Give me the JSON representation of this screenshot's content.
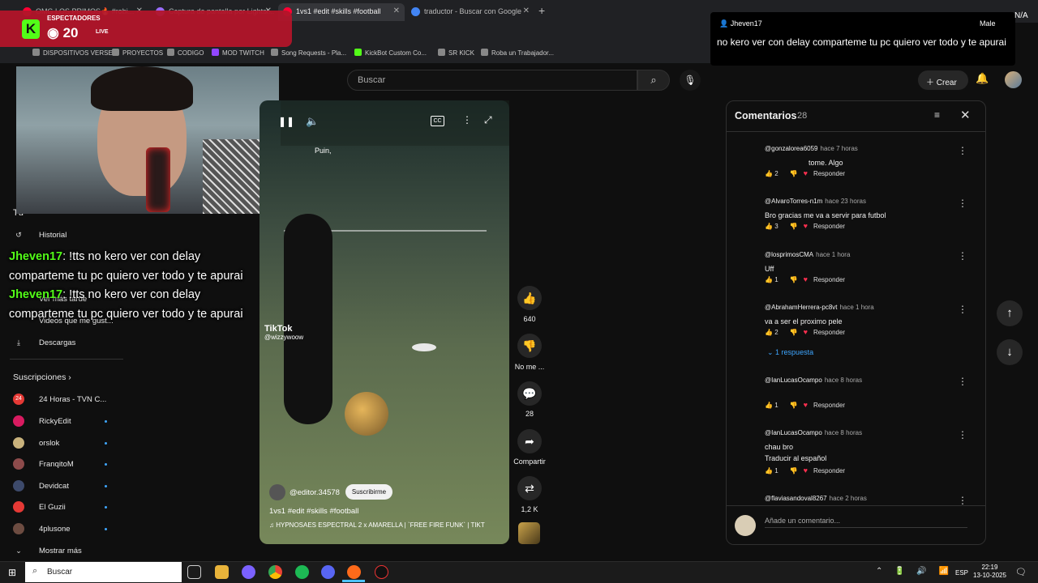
{
  "browser": {
    "tabs": [
      {
        "label": "OMG LOS PRIMOS🔥 #robi...",
        "favicon_color": "#ff0033"
      },
      {
        "label": "Captura de pantalla por Lightsl...",
        "favicon_color": "#9b6bff"
      },
      {
        "label": "1vs1 #edit #skills #football",
        "favicon_color": "#ff0033"
      },
      {
        "label": "traductor - Buscar con Google",
        "favicon_color": "#4285f4"
      }
    ],
    "new_tab": "+",
    "bookmarks": [
      {
        "label": "DISPOSITIVOS VERSE"
      },
      {
        "label": "PROYECTOS"
      },
      {
        "label": "CODIGO"
      },
      {
        "label": "MOD TWITCH"
      },
      {
        "label": "Song Requests - Pla..."
      },
      {
        "label": "KickBot Custom Co..."
      },
      {
        "label": "SR KICK"
      },
      {
        "label": "Roba un Trabajador..."
      }
    ]
  },
  "overlay": {
    "spectators_label": "ESPECTADORES",
    "viewers": "20",
    "live_label": "LIVE",
    "kick_logo": "K",
    "tts_user": "Jheven17",
    "tts_voice": "Male",
    "tts_message": "no kero ver con delay comparteme tu pc quiero ver todo y te apurai",
    "top_right_text": "N/A",
    "stream_chat": [
      {
        "user": "Jheven17",
        "message": ": !tts no kero ver con delay comparteme tu pc quiero ver todo y te apurai"
      },
      {
        "user": "Jheven17",
        "message": ": !tts no kero ver con delay comparteme tu pc quiero ver todo y te apurai"
      }
    ]
  },
  "youtube": {
    "search_placeholder": "Buscar",
    "create_label": "Crear",
    "sidebar": {
      "you_label": "Tú",
      "items": [
        {
          "label": "Historial"
        },
        {
          "label": "Ver más tarde"
        },
        {
          "label": "Videos que me gust..."
        },
        {
          "label": "Descargas"
        }
      ],
      "subscriptions_label": "Suscripciones",
      "subscriptions": [
        {
          "name": "24 Horas - TVN C...",
          "color": "#e53935",
          "icon": "24"
        },
        {
          "name": "RickyEdit",
          "color": "#d81b60",
          "icon": ""
        },
        {
          "name": "orslok",
          "color": "#c9b27c",
          "icon": ""
        },
        {
          "name": "FranqitoM",
          "color": "#8d4b4b",
          "icon": ""
        },
        {
          "name": "Devidcat",
          "color": "#3d4a6b",
          "icon": ""
        },
        {
          "name": "El Guzii",
          "color": "#e53935",
          "icon": ""
        },
        {
          "name": "4plusone",
          "color": "#6d4c41",
          "icon": ""
        }
      ],
      "show_more": "Mostrar más"
    },
    "video": {
      "caption": "Puin,",
      "tiktok_brand": "TikTok",
      "tiktok_user": "@wizzywoow",
      "channel": "@editor.34578",
      "subscribe": "Suscribirme",
      "title": "1vs1 #edit #skills #football",
      "music": "♫ HYPNOSAES ESPECTRAL 2 x AMARELLA | `FREE FIRE FUNK` | TIKT"
    },
    "actions": {
      "likes": "640",
      "dislike": "No me ...",
      "comments": "28",
      "share": "Compartir",
      "remix": "1,2 K"
    },
    "comments_panel": {
      "title": "Comentarios",
      "count": "28",
      "reply_label": "Responder",
      "replies_toggle": "1 respuesta",
      "add_placeholder": "Añade un comentario...",
      "items": [
        {
          "author": "@gonzalorea6059",
          "time": "hace 7 horas",
          "text": "tome. Algo",
          "likes": "2"
        },
        {
          "author": "@AlvaroTorres-n1m",
          "time": "hace 23 horas",
          "text": "Bro gracias me va a servir para futbol",
          "likes": "3"
        },
        {
          "author": "@losprimosCMA",
          "time": "hace 1 hora",
          "text": "Uff",
          "likes": "1"
        },
        {
          "author": "@AbrahamHerrera-pc8vt",
          "time": "hace 1 hora",
          "text": "va a ser el proximo pele",
          "likes": "2"
        },
        {
          "author": "@IanLucasOcampo",
          "time": "hace 8 horas",
          "text": "",
          "likes": "1"
        },
        {
          "author": "@IanLucasOcampo",
          "time": "hace 8 horas",
          "text": "chau bro",
          "translate": "Traducir al español",
          "likes": "1"
        },
        {
          "author": "@flaviasandoval8267",
          "time": "hace 2 horas",
          "text": "",
          "likes": ""
        }
      ]
    }
  },
  "taskbar": {
    "search_label": "Buscar",
    "language": "ESP",
    "time": "22:19",
    "date": "13-10-2025"
  }
}
